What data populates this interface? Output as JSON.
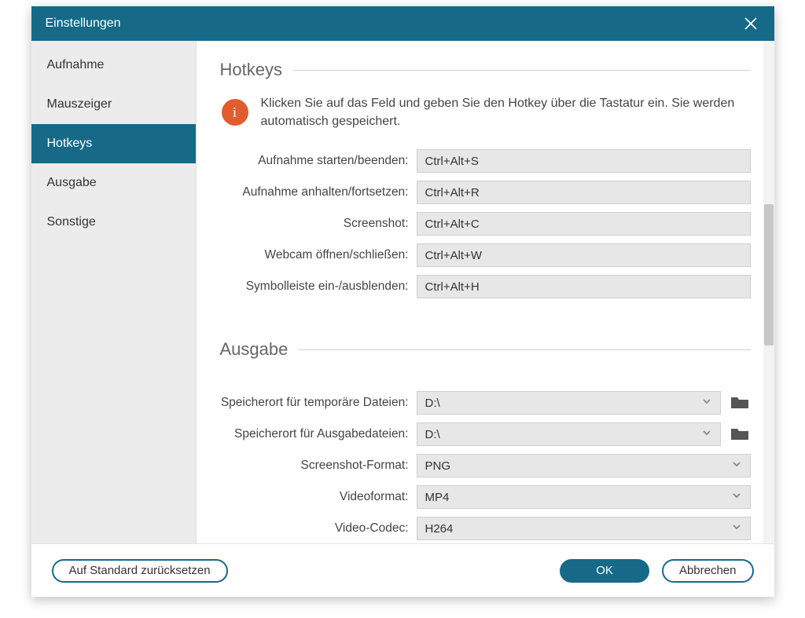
{
  "title": "Einstellungen",
  "sidebar": {
    "items": [
      {
        "label": "Aufnahme",
        "active": false
      },
      {
        "label": "Mauszeiger",
        "active": false
      },
      {
        "label": "Hotkeys",
        "active": true
      },
      {
        "label": "Ausgabe",
        "active": false
      },
      {
        "label": "Sonstige",
        "active": false
      }
    ]
  },
  "hotkeys": {
    "heading": "Hotkeys",
    "info": "Klicken Sie auf das Feld und geben Sie den Hotkey über die Tastatur ein. Sie werden automatisch gespeichert.",
    "rows": [
      {
        "label": "Aufnahme starten/beenden:",
        "value": "Ctrl+Alt+S"
      },
      {
        "label": "Aufnahme anhalten/fortsetzen:",
        "value": "Ctrl+Alt+R"
      },
      {
        "label": "Screenshot:",
        "value": "Ctrl+Alt+C"
      },
      {
        "label": "Webcam öffnen/schließen:",
        "value": "Ctrl+Alt+W"
      },
      {
        "label": "Symbolleiste ein-/ausblenden:",
        "value": "Ctrl+Alt+H"
      }
    ]
  },
  "output": {
    "heading": "Ausgabe",
    "rows": [
      {
        "label": "Speicherort für temporäre Dateien:",
        "value": "D:\\",
        "folder": true
      },
      {
        "label": "Speicherort für Ausgabedateien:",
        "value": "D:\\",
        "folder": true
      },
      {
        "label": "Screenshot-Format:",
        "value": "PNG",
        "folder": false
      },
      {
        "label": "Videoformat:",
        "value": "MP4",
        "folder": false
      },
      {
        "label": "Video-Codec:",
        "value": "H264",
        "folder": false
      }
    ]
  },
  "footer": {
    "reset": "Auf Standard zurücksetzen",
    "ok": "OK",
    "cancel": "Abbrechen"
  }
}
